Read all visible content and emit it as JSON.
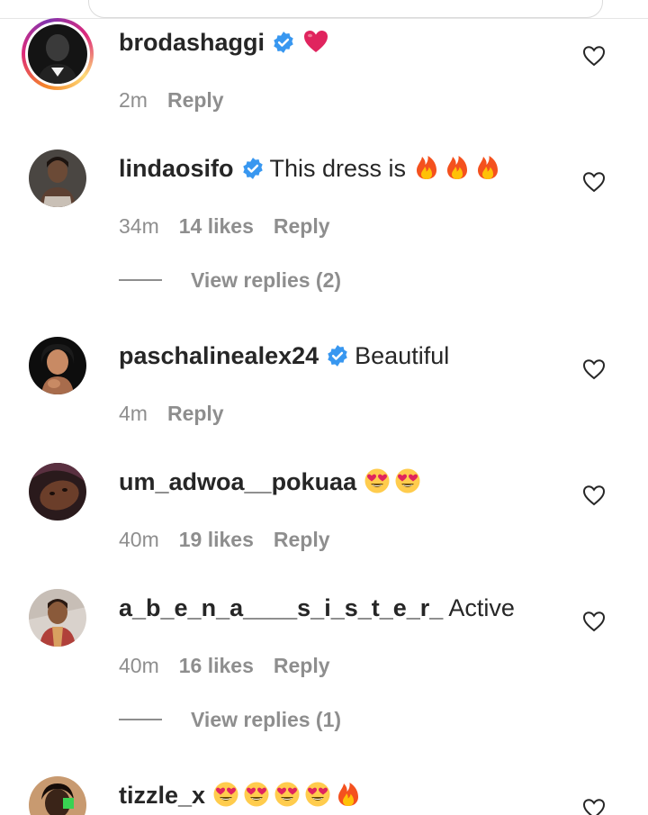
{
  "colors": {
    "verified_blue": "#3897f0",
    "heart_red": "#e0245e",
    "text_primary": "#262626",
    "text_secondary": "#8e8e8e"
  },
  "comments": [
    {
      "username": "brodashaggi",
      "verified": true,
      "text": "",
      "emojis": [
        "red-heart"
      ],
      "time": "2m",
      "likes": "",
      "reply_label": "Reply",
      "view_replies": ""
    },
    {
      "username": "lindaosifo",
      "verified": true,
      "text": "This dress is",
      "emojis": [
        "fire",
        "fire",
        "fire"
      ],
      "time": "34m",
      "likes": "14 likes",
      "reply_label": "Reply",
      "view_replies": "View replies (2)"
    },
    {
      "username": "paschalinealex24",
      "verified": true,
      "text": "Beautiful",
      "emojis": [],
      "time": "4m",
      "likes": "",
      "reply_label": "Reply",
      "view_replies": ""
    },
    {
      "username": "um_adwoa__pokuaa",
      "verified": false,
      "text": "",
      "emojis": [
        "heart-eyes",
        "heart-eyes"
      ],
      "time": "40m",
      "likes": "19 likes",
      "reply_label": "Reply",
      "view_replies": ""
    },
    {
      "username": "a_b_e_n_a____s_i_s_t_e_r_",
      "verified": false,
      "text": "Active",
      "emojis": [],
      "time": "40m",
      "likes": "16 likes",
      "reply_label": "Reply",
      "view_replies": "View replies (1)"
    },
    {
      "username": "tizzle_x",
      "verified": false,
      "text": "",
      "emojis": [
        "heart-eyes",
        "heart-eyes",
        "heart-eyes",
        "heart-eyes",
        "fire"
      ],
      "time": "",
      "likes": "",
      "reply_label": "",
      "view_replies": ""
    }
  ]
}
